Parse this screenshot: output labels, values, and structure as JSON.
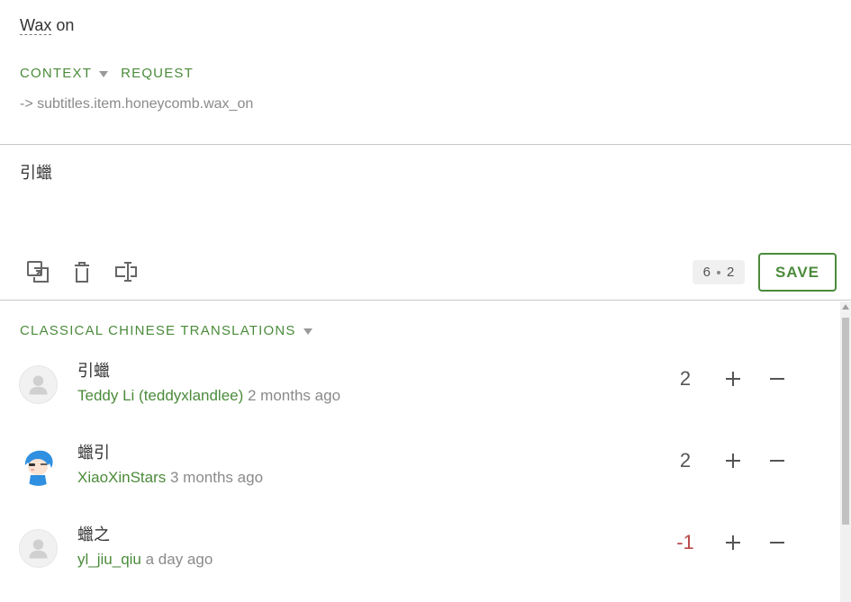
{
  "source": {
    "word": "Wax",
    "rest": " on"
  },
  "tabs": [
    {
      "label": "CONTEXT",
      "has_caret": true
    },
    {
      "label": "REQUEST",
      "has_caret": false
    }
  ],
  "context_line": "-> subtitles.item.honeycomb.wax_on",
  "editor": {
    "text": "引蠟",
    "tools": [
      "copy-source-icon",
      "delete-icon",
      "text-cursor-icon"
    ],
    "counter": {
      "left": "6",
      "right": "2"
    },
    "save_label": "SAVE"
  },
  "translations": {
    "title": "CLASSICAL CHINESE TRANSLATIONS",
    "items": [
      {
        "text": "引蠟",
        "user": "Teddy Li (teddyxlandlee)",
        "time": " 2 months ago",
        "votes": "2",
        "avatar": "default-avatar",
        "negative": false
      },
      {
        "text": "蠟引",
        "user": "XiaoXinStars",
        "time": " 3 months ago",
        "votes": "2",
        "avatar": "custom-avatar",
        "negative": false
      },
      {
        "text": "蠟之",
        "user": "yl_jiu_qiu",
        "time": " a day ago",
        "votes": "-1",
        "avatar": "default-avatar",
        "negative": true
      }
    ]
  },
  "colors": {
    "accent": "#4b8b3b",
    "negative": "#b84a4a",
    "muted": "#8a8a8a"
  }
}
